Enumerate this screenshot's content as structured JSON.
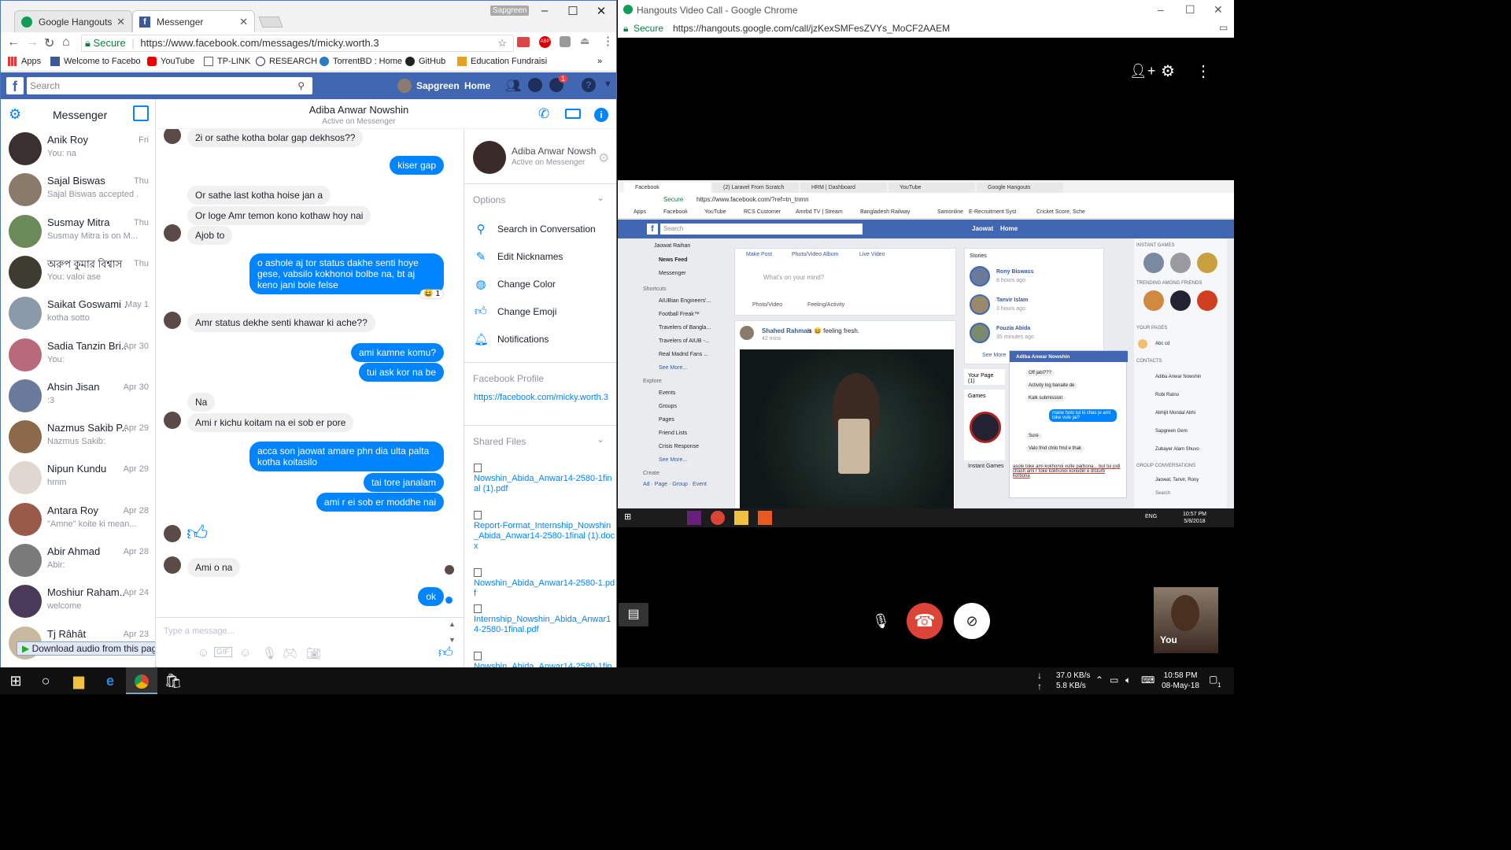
{
  "left_window": {
    "tabs": [
      {
        "label": "Google Hangouts"
      },
      {
        "label": "Messenger"
      }
    ],
    "profile_badge": "Sapgreen",
    "address": {
      "secure": "Secure",
      "url": "https://www.facebook.com/messages/t/micky.worth.3"
    },
    "bookmarks": [
      "Apps",
      "Welcome to Facebo",
      "YouTube",
      "TP-LINK",
      "RESEARCH",
      "TorrentBD : Home",
      "GitHub",
      "Education Fundraisi"
    ],
    "facebook_bar": {
      "search_placeholder": "Search",
      "user": "Sapgreen",
      "home": "Home",
      "notif_count": "1"
    },
    "messenger": {
      "title": "Messenger",
      "conversations": [
        {
          "name": "Anik Roy",
          "preview": "You: na",
          "date": "Fri",
          "color": "#3a3030"
        },
        {
          "name": "Sajal Biswas",
          "preview": "Sajal Biswas accepted ...",
          "date": "Thu",
          "color": "#8a7a6a"
        },
        {
          "name": "Susmay Mitra",
          "preview": "Susmay Mitra is on M...",
          "date": "Thu",
          "color": "#6a8a5a"
        },
        {
          "name": "অরুপ কুমার বিশ্বাস",
          "preview": "You: valoi ase",
          "date": "Thu",
          "color": "#3c3c30"
        },
        {
          "name": "Saikat Goswami ...",
          "preview": "kotha sotto",
          "date": "May 1",
          "color": "#8a9aa8"
        },
        {
          "name": "Sadia Tanzin Bri...",
          "preview": "You:",
          "date": "Apr 30",
          "color": "#b86a7a"
        },
        {
          "name": "Ahsin Jisan",
          "preview": ":3",
          "date": "Apr 30",
          "color": "#6a7a9a"
        },
        {
          "name": "Nazmus Sakib P...",
          "preview": "Nazmus Sakib:",
          "date": "Apr 29",
          "color": "#8a6a4a"
        },
        {
          "name": "Nipun Kundu",
          "preview": "hmm",
          "date": "Apr 29",
          "color": "#e0d8d0"
        },
        {
          "name": "Antara Roy",
          "preview": "\"Amne\" koite ki mean...",
          "date": "Apr 28",
          "color": "#9a5a4a"
        },
        {
          "name": "Abir Ahmad",
          "preview": "Abir:",
          "date": "Apr 28",
          "color": "#7a7a7a"
        },
        {
          "name": "Moshiur Raham...",
          "preview": "welcome",
          "date": "Apr 24",
          "color": "#4a3a5a"
        },
        {
          "name": "Tj Râhât",
          "preview": "",
          "date": "Apr 23",
          "color": "#c8b8a0"
        }
      ],
      "download_bar": "Download audio from this page",
      "chat_header": {
        "name": "Adiba Anwar Nowshin",
        "status": "Active on Messenger"
      },
      "messages": {
        "m1": "2i or sathe kotha bolar gap dekhsos??",
        "m2": "kiser gap",
        "m3": "Or sathe last kotha hoise jan a",
        "m4": "Or loge Amr temon kono kothaw hoy nai",
        "m5": "Ajob to",
        "m6": "o ashole aj tor status dakhe senti hoye gese, vabsilo kokhonoi bolbe na, bt aj keno jani bole felse",
        "m6_reaction": "1",
        "m7": "Amr status dekhe senti khawar ki ache??",
        "m8": "ami kamne komu?",
        "m9": "tui ask kor na be",
        "m10": "Na",
        "m11": "Ami r kichu koitam na ei sob er pore",
        "m12": "acca son jaowat amare phn dia ulta palta kotha koitasilo",
        "m13": "tai tore janalam",
        "m14": "ami r ei sob er moddhe nai",
        "m15": "Ami o na",
        "m16": "ok"
      },
      "composer_placeholder": "Type a message...",
      "info": {
        "name": "Adiba Anwar Nowsh",
        "status": "Active on Messenger",
        "options_title": "Options",
        "options": [
          "Search in Conversation",
          "Edit Nicknames",
          "Change Color",
          "Change Emoji",
          "Notifications"
        ],
        "profile_title": "Facebook Profile",
        "profile_link": "https://facebook.com/micky.worth.3",
        "shared_title": "Shared Files",
        "files": [
          "Nowshin_Abida_Anwar14-2580-1final (1).pdf",
          "Report-Format_Internship_Nowshin_Abida_Anwar14-2580-1final (1).docx",
          "Nowshin_Abida_Anwar14-2580-1.pdf",
          "Internship_Nowshin_Abida_Anwar14-2580-1final.pdf",
          "Nowshin_Abida_Anwar14-2580-1final (1).pdf"
        ]
      }
    }
  },
  "right_window": {
    "title": "Hangouts Video Call - Google Chrome",
    "secure": "Secure",
    "url": "https://hangouts.google.com/call/jzKexSMFesZVYs_MoCF2AAEM",
    "self_label": "You",
    "shared_screen": {
      "tabs": [
        "Facebook",
        "(2) Laravel From Scratch",
        "HRM | Dashboard",
        "YouTube",
        "Google Hangouts"
      ],
      "url": "https://www.facebook.com/?ref=tn_tnmn",
      "secure": "Secure",
      "bookmarks": [
        "Apps",
        "Facebook",
        "YouTube",
        "RCS Customer",
        "Amrbd TV | Stream",
        "Bangladesh Railway",
        "Samonline",
        "E-Recruitment Syst",
        "Cricket Score, Sche"
      ],
      "search": "Search",
      "user": "Jaowat",
      "home": "Home",
      "left_nav": {
        "name": "Jaowat Raihan",
        "items": [
          "News Feed",
          "Messenger"
        ],
        "shortcuts_title": "Shortcuts",
        "shortcuts": [
          "AIUBian Engineers'...",
          "Football Freak™",
          "Travelers of Bangla...",
          "Travelers of AIUB -...",
          "Real Madrid Fans ..."
        ],
        "see_more": "See More...",
        "explore_title": "Explore",
        "explore": [
          "Events",
          "Groups",
          "Pages",
          "Friend Lists",
          "Crisis Response"
        ],
        "create_title": "Create",
        "create": "Ad · Page · Group · Event"
      },
      "composer": {
        "tabs": [
          "Make Post",
          "Photo/Video Album",
          "Live Video"
        ],
        "prompt": "What's on your mind?",
        "actions": [
          "Photo/Video",
          "Feeling/Activity"
        ]
      },
      "post": {
        "author": "Shahed Rahman",
        "suffix": "is 😆 feeling fresh.",
        "time": "42 mins"
      },
      "stories": {
        "title": "Stories",
        "items": [
          {
            "name": "Rony Biswass",
            "time": "8 hours ago"
          },
          {
            "name": "Tanvir Islam",
            "time": "3 hours ago"
          },
          {
            "name": "Fouzia Abida",
            "time": "35 minutes ago"
          }
        ],
        "see_more": "See More"
      },
      "your_page": "Your Page (1)",
      "games": "Games",
      "instant_games": "Instant Games",
      "chat_popup": {
        "title": "Adiba Anwar Nowshin",
        "lines": [
          "Off jabi???",
          "Activity log banaite de",
          "Kalk submission"
        ],
        "out": "mane holo tui ki chas je ami toke vule jai?",
        "lines2": [
          "Sure",
          "Valo fmd chilo fmd e thak"
        ],
        "typing": "asole toke ami kokhonoi vulte parbona... but tui jodi chash ami r toke kokhonoi konodin e disturb korbona"
      },
      "right_col": {
        "instant_games": "INSTANT GAMES",
        "trending": "TRENDING AMONG FRIENDS",
        "your_pages": "YOUR PAGES",
        "page": "Abc cd",
        "contacts_title": "CONTACTS",
        "contacts": [
          "Adiba Anwar Nowshin",
          "Robi Ratno",
          "Abhijit Mondal Abhi",
          "Sapgreen Gem",
          "Zubayer Alam Shuvo"
        ],
        "group_conv": "GROUP CONVERSATIONS",
        "group": "Jaowat, Tanvir, Rony",
        "search": "Search"
      },
      "clock": {
        "time": "10:57 PM",
        "date": "5/8/2018"
      },
      "lang": "ENG"
    }
  },
  "taskbar": {
    "net_down": "37.0 KB/s",
    "net_up": "5.8 KB/s",
    "time": "10:58 PM",
    "date": "08-May-18",
    "notif": "1"
  }
}
